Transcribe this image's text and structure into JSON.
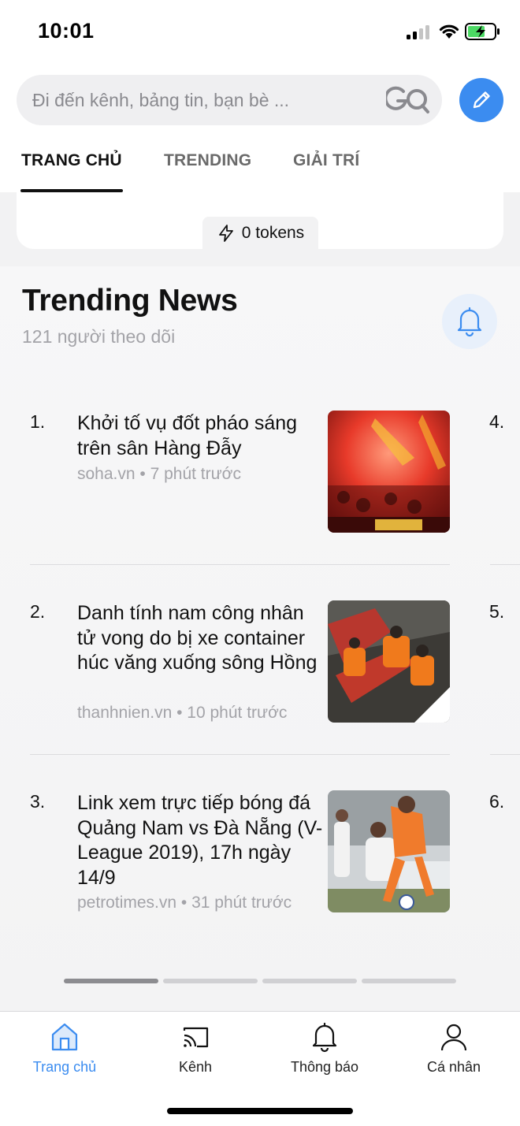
{
  "status_bar": {
    "time": "10:01"
  },
  "search": {
    "placeholder": "Đi đến kênh, bảng tin, bạn bè ..."
  },
  "tabs": [
    {
      "label": "TRANG CHỦ",
      "active": true
    },
    {
      "label": "TRENDING",
      "active": false
    },
    {
      "label": "GIẢI TRÍ",
      "active": false
    }
  ],
  "tokens": {
    "label": "0 tokens"
  },
  "panel": {
    "title": "Trending News",
    "followers": "121 người theo dõi"
  },
  "news": [
    {
      "rank": "1.",
      "title": "Khởi tố vụ đốt pháo sáng trên sân Hàng Đẫy",
      "source": "soha.vn",
      "time": "7 phút trước",
      "meta": "soha.vn • 7 phút trước"
    },
    {
      "rank": "2.",
      "title": "Danh tính nam công nhân tử vong do bị xe container húc văng xuống sông Hồng",
      "source": "thanhnien.vn",
      "time": "10 phút trước",
      "meta": "thanhnien.vn • 10 phút trước"
    },
    {
      "rank": "3.",
      "title": "Link xem trực tiếp bóng đá Quảng Nam vs Đà Nẵng (V-League 2019), 17h ngày 14/9",
      "source": "petrotimes.vn",
      "time": "31 phút trước",
      "meta": "petrotimes.vn • 31 phút trước"
    }
  ],
  "next_column_ranks": [
    "4.",
    "5.",
    "6."
  ],
  "pager": {
    "pages": 4,
    "active_index": 0
  },
  "bottom_nav": [
    {
      "label": "Trang chủ",
      "icon": "home-icon",
      "active": true
    },
    {
      "label": "Kênh",
      "icon": "cast-icon",
      "active": false
    },
    {
      "label": "Thông báo",
      "icon": "bell-icon",
      "active": false
    },
    {
      "label": "Cá nhân",
      "icon": "person-icon",
      "active": false
    }
  ],
  "colors": {
    "accent": "#3b8cf0",
    "background_gray": "#f2f2f3",
    "meta_text": "#a3a3a8"
  }
}
